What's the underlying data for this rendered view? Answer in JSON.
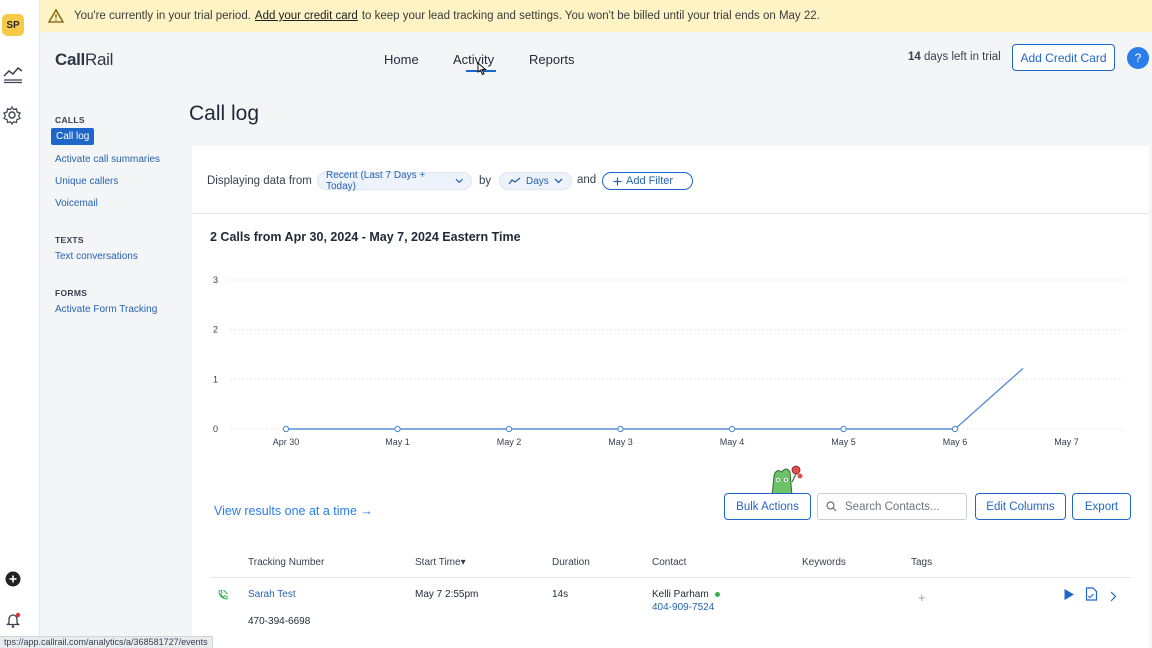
{
  "user": {
    "initials": "SP"
  },
  "banner": {
    "pre": "You're currently in your trial period.",
    "link": "Add your credit card",
    "post": "to keep your lead tracking and settings. You won't be billed until your trial ends on May 22."
  },
  "header": {
    "logo_a": "Call",
    "logo_b": "Rail",
    "nav": [
      "Home",
      "Activity",
      "Reports"
    ],
    "trial_days": "14",
    "trial_text": "days left in trial",
    "credit_button": "Add Credit Card",
    "help": "?"
  },
  "sidenav": {
    "calls_title": "CALLS",
    "calls": [
      "Call log",
      "Activate call summaries",
      "Unique callers",
      "Voicemail"
    ],
    "texts_title": "TEXTS",
    "texts": [
      "Text conversations"
    ],
    "forms_title": "FORMS",
    "forms": [
      "Activate Form Tracking"
    ]
  },
  "page_title": "Call log",
  "filters": {
    "prefix": "Displaying data from",
    "range": "Recent (Last 7 Days + Today)",
    "by": "by",
    "granularity": "Days",
    "and": "and",
    "add_filter": "Add Filter"
  },
  "chart_data": {
    "type": "line",
    "title": "2 Calls from Apr 30, 2024 - May 7, 2024 Eastern Time",
    "categories": [
      "Apr 30",
      "May 1",
      "May 2",
      "May 3",
      "May 4",
      "May 5",
      "May 6",
      "May 7"
    ],
    "series": [
      {
        "values": [
          0,
          0,
          0,
          0,
          0,
          0,
          0,
          2
        ]
      }
    ],
    "yticks": [
      0,
      1,
      2,
      3
    ],
    "ylim": [
      0,
      3
    ],
    "grid": true,
    "color": "#5b8fd6"
  },
  "toolbar": {
    "view_link": "View results one at a time →",
    "bulk": "Bulk Actions",
    "search_placeholder": "Search Contacts...",
    "edit_columns": "Edit Columns",
    "export": "Export"
  },
  "table": {
    "headers": [
      "Tracking Number",
      "Start Time▾",
      "Duration",
      "Contact",
      "Keywords",
      "Tags"
    ],
    "rows": [
      {
        "tracking_name": "Sarah Test",
        "tracking_number": "470-394-6698",
        "start_time": "May 7 2:55pm",
        "duration": "14s",
        "contact_name": "Kelli Parham",
        "contact_phone": "404-909-7524",
        "tags": "+"
      }
    ]
  },
  "statusbar": "tps://app.callrail.com/analytics/a/368581727/events"
}
